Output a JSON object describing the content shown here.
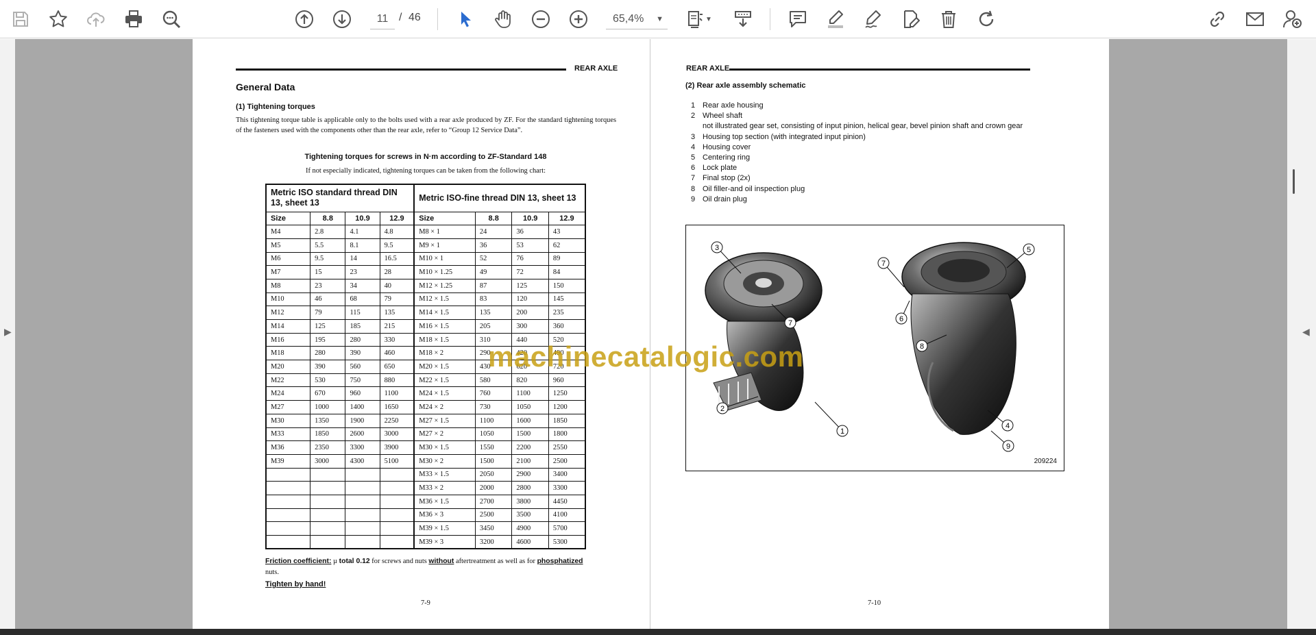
{
  "toolbar": {
    "current_page": "11",
    "page_separator": "/",
    "total_pages": "46",
    "zoom": "65,4%"
  },
  "left_page": {
    "header": "REAR AXLE",
    "title": "General Data",
    "subtitle": "(1)  Tightening torques",
    "paragraph": "This tightening torque table is applicable only to the bolts used with a rear axle produced by ZF. For the standard tightening torques of the fasteners used with the components other than the rear axle, refer to “Group 12 Service Data”.",
    "table_caption": "Tightening torques for screws in N·m according to ZF-Standard 148",
    "table_note": "If not especially indicated, tightening torques can be taken from the following chart:",
    "table": {
      "group_left": "Metric ISO standard thread DIN 13, sheet 13",
      "group_right": "Metric ISO-fine thread DIN 13, sheet 13",
      "columns": [
        "Size",
        "8.8",
        "10.9",
        "12.9",
        "Size",
        "8.8",
        "10.9",
        "12.9"
      ],
      "rows": [
        [
          "M4",
          "2.8",
          "4.1",
          "4.8",
          "M8 × 1",
          "24",
          "36",
          "43"
        ],
        [
          "M5",
          "5.5",
          "8.1",
          "9.5",
          "M9 × 1",
          "36",
          "53",
          "62"
        ],
        [
          "M6",
          "9.5",
          "14",
          "16.5",
          "M10 × 1",
          "52",
          "76",
          "89"
        ],
        [
          "M7",
          "15",
          "23",
          "28",
          "M10 × 1.25",
          "49",
          "72",
          "84"
        ],
        [
          "M8",
          "23",
          "34",
          "40",
          "M12 × 1.25",
          "87",
          "125",
          "150"
        ],
        [
          "M10",
          "46",
          "68",
          "79",
          "M12 × 1.5",
          "83",
          "120",
          "145"
        ],
        [
          "M12",
          "79",
          "115",
          "135",
          "M14 × 1.5",
          "135",
          "200",
          "235"
        ],
        [
          "M14",
          "125",
          "185",
          "215",
          "M16 × 1.5",
          "205",
          "300",
          "360"
        ],
        [
          "M16",
          "195",
          "280",
          "330",
          "M18 × 1.5",
          "310",
          "440",
          "520"
        ],
        [
          "M18",
          "280",
          "390",
          "460",
          "M18 × 2",
          "290",
          "420",
          "490"
        ],
        [
          "M20",
          "390",
          "560",
          "650",
          "M20 × 1.5",
          "430",
          "620",
          "720"
        ],
        [
          "M22",
          "530",
          "750",
          "880",
          "M22 × 1.5",
          "580",
          "820",
          "960"
        ],
        [
          "M24",
          "670",
          "960",
          "1100",
          "M24 × 1.5",
          "760",
          "1100",
          "1250"
        ],
        [
          "M27",
          "1000",
          "1400",
          "1650",
          "M24 × 2",
          "730",
          "1050",
          "1200"
        ],
        [
          "M30",
          "1350",
          "1900",
          "2250",
          "M27 × 1.5",
          "1100",
          "1600",
          "1850"
        ],
        [
          "M33",
          "1850",
          "2600",
          "3000",
          "M27 × 2",
          "1050",
          "1500",
          "1800"
        ],
        [
          "M36",
          "2350",
          "3300",
          "3900",
          "M30 × 1.5",
          "1550",
          "2200",
          "2550"
        ],
        [
          "M39",
          "3000",
          "4300",
          "5100",
          "M30 × 2",
          "1500",
          "2100",
          "2500"
        ],
        [
          "",
          "",
          "",
          "",
          "M33 × 1.5",
          "2050",
          "2900",
          "3400"
        ],
        [
          "",
          "",
          "",
          "",
          "M33 × 2",
          "2000",
          "2800",
          "3300"
        ],
        [
          "",
          "",
          "",
          "",
          "M36 × 1.5",
          "2700",
          "3800",
          "4450"
        ],
        [
          "",
          "",
          "",
          "",
          "M36 × 3",
          "2500",
          "3500",
          "4100"
        ],
        [
          "",
          "",
          "",
          "",
          "M39 × 1.5",
          "3450",
          "4900",
          "5700"
        ],
        [
          "",
          "",
          "",
          "",
          "M39 × 3",
          "3200",
          "4600",
          "5300"
        ]
      ]
    },
    "friction_label": "Friction coefficient:",
    "friction_mu": "µ",
    "friction_total": "total 0.12",
    "friction_text1": "for screws and nuts",
    "friction_without": "without",
    "friction_text2": "aftertreatment as well as for",
    "friction_phosphatized": "phosphatized",
    "friction_text3": "nuts.",
    "tighten": "Tighten by hand!",
    "page_number": "7-9"
  },
  "right_page": {
    "header": "REAR AXLE",
    "subtitle": "(2)  Rear axle assembly schematic",
    "parts": [
      {
        "n": "1",
        "label": "Rear axle housing"
      },
      {
        "n": "2",
        "label": "Wheel shaft"
      },
      {
        "n": "",
        "label": "not illustrated gear set, consisting of input pinion, helical gear, bevel pinion shaft and crown gear"
      },
      {
        "n": "3",
        "label": "Housing top section (with integrated input pinion)"
      },
      {
        "n": "4",
        "label": "Housing cover"
      },
      {
        "n": "5",
        "label": "Centering ring"
      },
      {
        "n": "6",
        "label": "Lock plate"
      },
      {
        "n": "7",
        "label": "Final stop (2x)"
      },
      {
        "n": "8",
        "label": "Oil filler-and oil inspection plug"
      },
      {
        "n": "9",
        "label": "Oil drain plug"
      }
    ],
    "callouts": [
      "3",
      "7",
      "2",
      "1",
      "7",
      "5",
      "6",
      "8",
      "4",
      "9"
    ],
    "figure_code": "209224",
    "page_number": "7-10"
  },
  "watermark": "machinecatalogic.com"
}
